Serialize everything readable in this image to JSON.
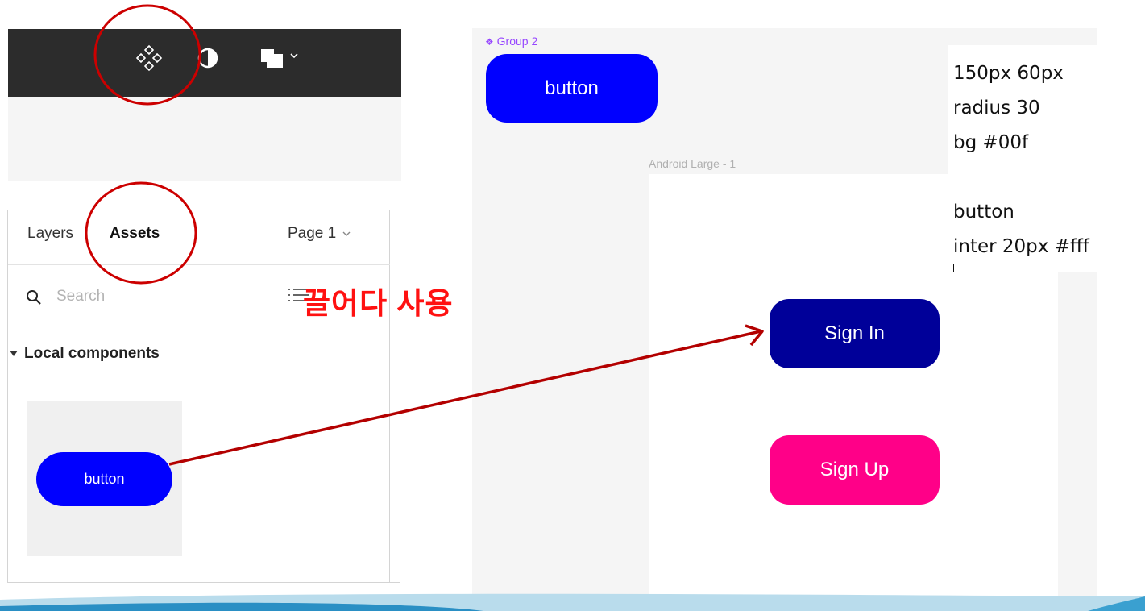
{
  "toolbar": {
    "icons": [
      "components-icon",
      "contrast-icon",
      "layers-icon",
      "chevron-down-icon"
    ],
    "background": "#2c2c2c"
  },
  "assets_panel": {
    "tabs": [
      {
        "label": "Layers",
        "active": false
      },
      {
        "label": "Assets",
        "active": true
      }
    ],
    "page_selector": "Page 1",
    "search": {
      "placeholder": "Search",
      "value": ""
    },
    "section": {
      "label": "Local components"
    },
    "component": {
      "label": "button",
      "color": "#0000ff"
    }
  },
  "canvas": {
    "group": {
      "label": "Group 2",
      "button_label": "button",
      "color": "#0000ff"
    },
    "frame": {
      "label": "Android Large - 1",
      "buttons": [
        {
          "label": "Sign In",
          "color": "#000099"
        },
        {
          "label": "Sign Up",
          "color": "#ff0088"
        }
      ]
    }
  },
  "note": {
    "lines": [
      "150px 60px",
      "radius 30",
      "bg #00f",
      "",
      "button",
      "inter 20px #fff"
    ]
  },
  "annotation": {
    "label": "끌어다 사용",
    "color": "#cc0000"
  }
}
